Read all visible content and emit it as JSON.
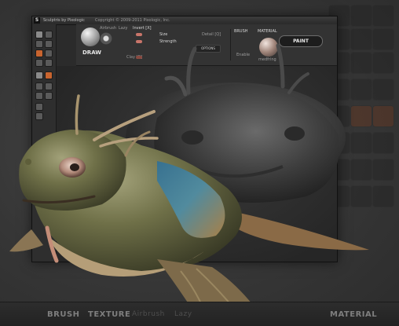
{
  "titlebar": {
    "logo": "S",
    "app_name": "Sculptris by Pixologic",
    "copyright": "Copyright © 2009-2011 Pixologic, Inc."
  },
  "shelf": {
    "draw_label": "DRAW",
    "airbrush": "Airbrush",
    "lazy": "Lazy",
    "invert": "Invert [X]",
    "size": "Size",
    "strength": "Strength",
    "detail": "Detail [Q]",
    "clay": "Clay [D]",
    "options": "OPTIONS",
    "brush_header": "BRUSH",
    "enable": "Enable",
    "material_header": "MATERIAL",
    "material_name": "medfring",
    "paint_button": "PAINT"
  },
  "bottombar": {
    "brush": "BRUSH",
    "texture": "TEXTURE",
    "airbrush": "Airbrush",
    "lazy": "Lazy",
    "material": "MATERIAL"
  },
  "colors": {
    "accent_orange": "#c8642f",
    "window_bg": "#2b2b2b",
    "creature_skin": "#7a7a52",
    "creature_blue": "#3f7fa0"
  }
}
